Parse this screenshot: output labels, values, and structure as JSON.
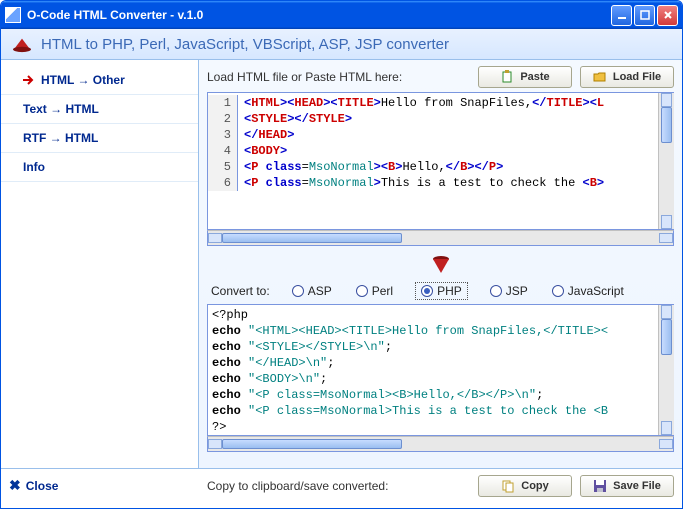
{
  "window": {
    "title": "O-Code HTML Converter - v.1.0"
  },
  "header": {
    "subtitle": "HTML to PHP, Perl, JavaScript, VBScript, ASP, JSP converter"
  },
  "sidebar": {
    "items": [
      {
        "label": "HTML → Other",
        "icon": "arrow-right-red",
        "active": true
      },
      {
        "label": "Text → HTML"
      },
      {
        "label": "RTF → HTML"
      },
      {
        "label": "Info"
      }
    ]
  },
  "topbar": {
    "label": "Load HTML file or Paste HTML here:",
    "paste_label": "Paste",
    "loadfile_label": "Load File"
  },
  "input_code": {
    "lines": [
      {
        "n": 1,
        "tokens": [
          [
            "<",
            "blue"
          ],
          [
            "HTML",
            "red"
          ],
          [
            "><",
            "blue"
          ],
          [
            "HEAD",
            "red"
          ],
          [
            "><",
            "blue"
          ],
          [
            "TITLE",
            "red"
          ],
          [
            ">",
            "blue"
          ],
          [
            "Hello from SnapFiles,",
            ""
          ],
          [
            "</",
            "blue"
          ],
          [
            "TITLE",
            "red"
          ],
          [
            "><",
            "blue"
          ],
          [
            "L",
            "red"
          ]
        ]
      },
      {
        "n": 2,
        "tokens": [
          [
            "<",
            "blue"
          ],
          [
            "STYLE",
            "red"
          ],
          [
            "></",
            "blue"
          ],
          [
            "STYLE",
            "red"
          ],
          [
            ">",
            "blue"
          ]
        ]
      },
      {
        "n": 3,
        "tokens": [
          [
            "</",
            "blue"
          ],
          [
            "HEAD",
            "red"
          ],
          [
            ">",
            "blue"
          ]
        ]
      },
      {
        "n": 4,
        "tokens": [
          [
            "<",
            "blue"
          ],
          [
            "BODY",
            "red"
          ],
          [
            ">",
            "blue"
          ]
        ]
      },
      {
        "n": 5,
        "tokens": [
          [
            "<",
            "blue"
          ],
          [
            "P",
            "red"
          ],
          [
            " ",
            ""
          ],
          [
            "class",
            "blue"
          ],
          [
            "=",
            ""
          ],
          [
            "MsoNormal",
            "teal"
          ],
          [
            "><",
            "blue"
          ],
          [
            "B",
            "red"
          ],
          [
            ">",
            "blue"
          ],
          [
            "Hello,",
            ""
          ],
          [
            "</",
            "blue"
          ],
          [
            "B",
            "red"
          ],
          [
            "></",
            "blue"
          ],
          [
            "P",
            "red"
          ],
          [
            ">",
            "blue"
          ]
        ]
      },
      {
        "n": 6,
        "tokens": [
          [
            "<",
            "blue"
          ],
          [
            "P",
            "red"
          ],
          [
            " ",
            ""
          ],
          [
            "class",
            "blue"
          ],
          [
            "=",
            ""
          ],
          [
            "MsoNormal",
            "teal"
          ],
          [
            ">",
            "blue"
          ],
          [
            "This is a test to check the ",
            ""
          ],
          [
            "<",
            "blue"
          ],
          [
            "B",
            "red"
          ],
          [
            ">",
            "blue"
          ]
        ]
      }
    ]
  },
  "convert": {
    "label": "Convert to:",
    "options": [
      {
        "label": "ASP",
        "selected": false
      },
      {
        "label": "Perl",
        "selected": false
      },
      {
        "label": "PHP",
        "selected": true
      },
      {
        "label": "JSP",
        "selected": false
      },
      {
        "label": "JavaScript",
        "selected": false
      }
    ]
  },
  "output_code": {
    "lines": [
      [
        [
          "<?php",
          ""
        ]
      ],
      [
        [
          "echo ",
          "k"
        ],
        [
          "\"<HTML><HEAD><TITLE>Hello from SnapFiles,</TITLE><",
          "str"
        ]
      ],
      [
        [
          "echo ",
          "k"
        ],
        [
          "\"<STYLE></STYLE>\\n\"",
          "str"
        ],
        [
          ";",
          ""
        ]
      ],
      [
        [
          "echo ",
          "k"
        ],
        [
          "\"</HEAD>\\n\"",
          "str"
        ],
        [
          ";",
          ""
        ]
      ],
      [
        [
          "echo ",
          "k"
        ],
        [
          "\"<BODY>\\n\"",
          "str"
        ],
        [
          ";",
          ""
        ]
      ],
      [
        [
          "echo ",
          "k"
        ],
        [
          "\"<P class=MsoNormal><B>Hello,</B></P>\\n\"",
          "str"
        ],
        [
          ";",
          ""
        ]
      ],
      [
        [
          "echo ",
          "k"
        ],
        [
          "\"<P class=MsoNormal>This is a test to check the <B",
          "str"
        ]
      ],
      [
        [
          "?>",
          ""
        ]
      ]
    ]
  },
  "footer": {
    "close_label": "Close",
    "copy_label": "Copy to clipboard/save converted:",
    "copy_btn": "Copy",
    "save_btn": "Save File"
  }
}
